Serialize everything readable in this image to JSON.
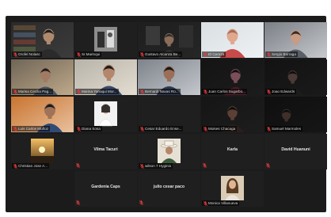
{
  "participants": [
    {
      "id": "p0",
      "name": "Orofel Nolasc"
    },
    {
      "id": "p1",
      "name": "Sr.Marinqui"
    },
    {
      "id": "p2",
      "name": "Gustavo Alcanza Be..."
    },
    {
      "id": "p3",
      "name": "El Cereza"
    },
    {
      "id": "p4",
      "name": "Sergio Borraga"
    },
    {
      "id": "p5",
      "name": "Marisa Cecilia Pag..."
    },
    {
      "id": "p6",
      "name": "Marina Yanaqui Mor..."
    },
    {
      "id": "p7",
      "name": "Bernardi Navas Ro..."
    },
    {
      "id": "p8",
      "name": "Juan Carlos Sugarbo..."
    },
    {
      "id": "p9",
      "name": "Joao Edwards"
    },
    {
      "id": "p10",
      "name": "Luis Carlos Muñoz"
    },
    {
      "id": "p11",
      "name": "Diana Sosa"
    },
    {
      "id": "p12",
      "name": "Cesar Eduardo Ense..."
    },
    {
      "id": "p13",
      "name": "Moises Chacaga"
    },
    {
      "id": "p14",
      "name": "Samuel Marmoles"
    },
    {
      "id": "p15",
      "name": "Christian Jose A..."
    },
    {
      "id": "p16",
      "name": "Vilma Tacuri"
    },
    {
      "id": "p17",
      "name": "wilson 7 Hyginio"
    },
    {
      "id": "p18",
      "name": "Karla"
    },
    {
      "id": "p19",
      "name": "David Huanuni"
    },
    {
      "id": "p20",
      "name": "Gardenia Caps"
    },
    {
      "id": "p21",
      "name": "julio cesar paco"
    },
    {
      "id": "p22",
      "name": "Monica Villanueva"
    }
  ],
  "icons": {
    "muted": "microphone-muted-icon"
  },
  "colors": {
    "gallery_background": "#1b1b1b",
    "tile_background": "#1f1f1f",
    "active_speaker_border": "#9ccd3a",
    "muted_icon": "#e23b3b"
  }
}
